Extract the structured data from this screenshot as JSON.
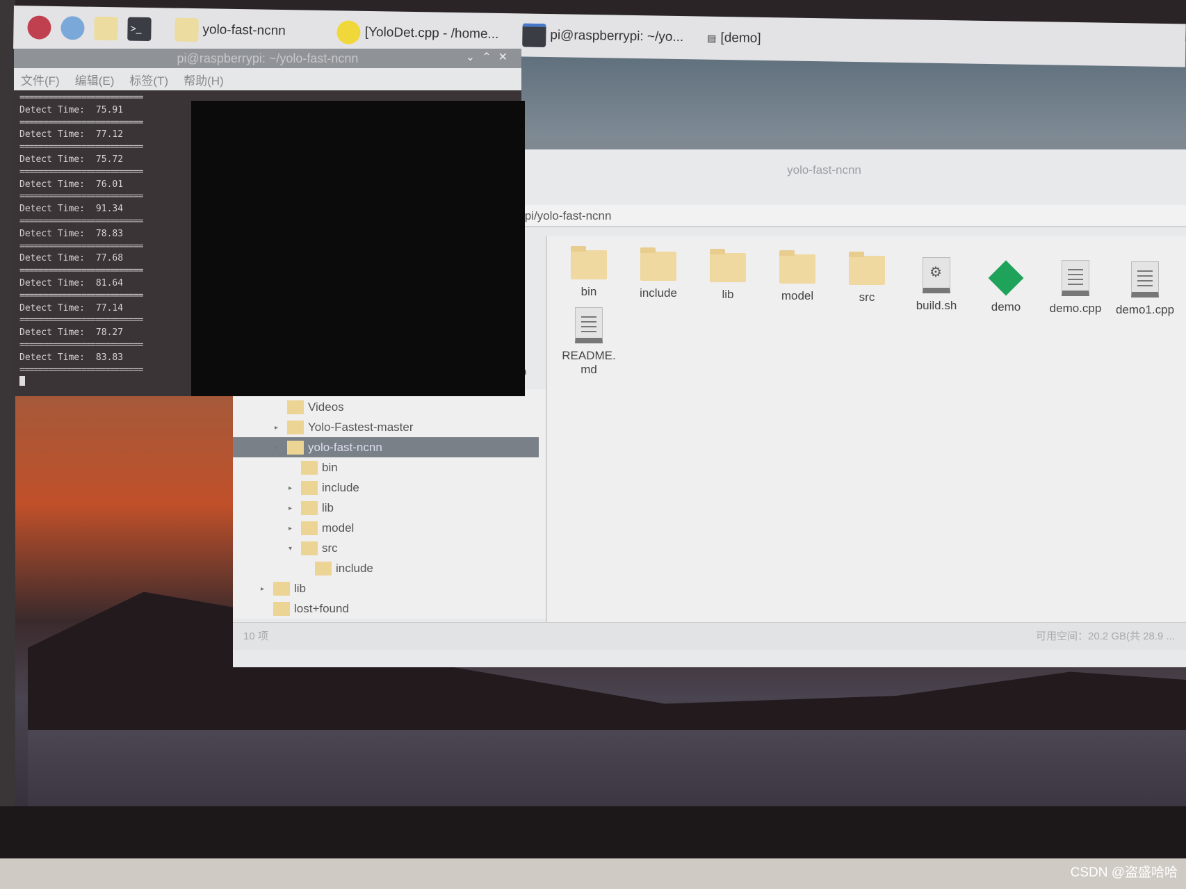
{
  "taskbar": {
    "tasks": [
      {
        "label": "yolo-fast-ncnn",
        "icon": "folder-icon"
      },
      {
        "label": "[YoloDet.cpp - /home...",
        "icon": "geany-icon"
      },
      {
        "label": "pi@raspberrypi: ~/yo...",
        "icon": "terminal-icon"
      },
      {
        "label": "[demo]",
        "icon": "window-icon"
      }
    ]
  },
  "terminal": {
    "title": "pi@raspberrypi: ~/yolo-fast-ncnn",
    "menu": [
      "文件(F)",
      "编辑(E)",
      "标签(T)",
      "帮助(H)"
    ],
    "separator": "==========================",
    "label": "Detect Time:",
    "times": [
      "75.91",
      "77.12",
      "75.72",
      "76.01",
      "91.34",
      "78.83",
      "77.68",
      "81.64",
      "77.14",
      "78.27",
      "83.83"
    ]
  },
  "file_manager": {
    "title": "yolo-fast-ncnn",
    "path": "/pi/yolo-fast-ncnn",
    "items": [
      {
        "name": "bin",
        "type": "folder"
      },
      {
        "name": "include",
        "type": "folder"
      },
      {
        "name": "lib",
        "type": "folder"
      },
      {
        "name": "model",
        "type": "folder"
      },
      {
        "name": "src",
        "type": "folder"
      },
      {
        "name": "build.sh",
        "type": "script"
      },
      {
        "name": "demo",
        "type": "executable"
      },
      {
        "name": "demo.cpp",
        "type": "text"
      },
      {
        "name": "demo1.cpp",
        "type": "text"
      },
      {
        "name": "README.md",
        "type": "text"
      }
    ],
    "tree": [
      {
        "label": "Videos",
        "expander": ""
      },
      {
        "label": "Yolo-Fastest-master",
        "expander": "▸"
      },
      {
        "label": "yolo-fast-ncnn",
        "expander": "▾",
        "selected": true
      },
      {
        "label": "bin",
        "expander": ""
      },
      {
        "label": "include",
        "expander": "▸"
      },
      {
        "label": "lib",
        "expander": "▸"
      },
      {
        "label": "model",
        "expander": "▸"
      },
      {
        "label": "src",
        "expander": "▾"
      },
      {
        "label": "include",
        "expander": ""
      },
      {
        "label": "lib",
        "expander": "▸"
      },
      {
        "label": "lost+found",
        "expander": ""
      }
    ],
    "partial_label": "cpp",
    "status_count": "10 项",
    "status_space": "可用空间：20.2 GB(共 28.9 ..."
  },
  "watermark": "CSDN @盗盛哈哈",
  "colors": {
    "selection": "#7a8088",
    "folder": "#f0d9a0",
    "demo_icon": "#1fa25a",
    "terminal_bg": "#0c0b0c"
  }
}
